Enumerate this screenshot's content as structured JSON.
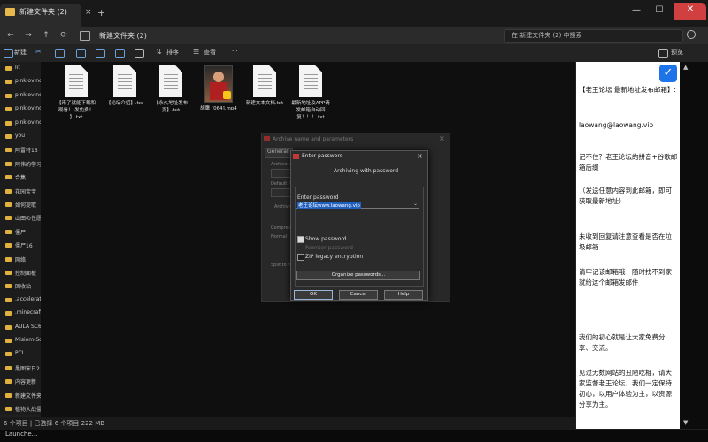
{
  "window": {
    "tab_title": "新建文件夹 (2)",
    "tab_close": "×",
    "tab_add": "+",
    "caption_minimize": "—",
    "caption_maximize": "☐",
    "caption_close": "✕"
  },
  "navigation": {
    "back": "←",
    "forward": "→",
    "up": "↑",
    "refresh": "⟳",
    "breadcrumb": "新建文件夹 (2)",
    "search_placeholder": "在 新建文件夹 (2) 中搜索"
  },
  "toolbar": {
    "new_label": "新建",
    "sort_label": "排序",
    "view_label": "查看",
    "more_label": "···",
    "preview_label": "预览"
  },
  "sidebar": {
    "items": [
      "lit",
      "pinklovinc",
      "pinklovinc",
      "pinklovinc",
      "pinklovinc",
      "you",
      "阿雷特13",
      "阿伟的学习",
      "合集",
      "花园宝宝",
      "如何提取",
      "山田の性愿",
      "僵尸",
      "僵尸16",
      "网络",
      "控制面板",
      "回收站",
      ".accelerate",
      ".minecraft",
      "AULA SC68",
      "Misiom-Sou",
      "PCL",
      "黑图宋日2",
      "内容更新",
      "新建文件夹",
      "植物大战僵尸"
    ]
  },
  "files": [
    {
      "name": "【来了就能下载和观看！ 发免费！ 】.txt",
      "type": "text"
    },
    {
      "name": "【论坛介绍】.txt",
      "type": "text"
    },
    {
      "name": "【永久地址发布页】.txt",
      "type": "text"
    },
    {
      "name": "胡鹰 [064].mp4",
      "type": "video"
    },
    {
      "name": "新建文本文档.txt",
      "type": "text"
    },
    {
      "name": "最新地址及APP请发邮箱自动回复！！！.txt",
      "type": "text"
    }
  ],
  "status": {
    "text": "6 个项目 | 已选择 6 个项目 222 MB"
  },
  "background_dialog": {
    "title": "Archive name and parameters",
    "tab_general": "General",
    "label_archive": "Archive n",
    "label_default": "Default P",
    "label_archive_format": "Archive",
    "label_compression": "Compress",
    "label_split": "Split to v",
    "field_normal": "Normal"
  },
  "dialog": {
    "title": "Enter password",
    "close": "×",
    "header": "Archiving with password",
    "enter_password_label": "Enter password",
    "password_value": "老王论坛www.laowang.vip",
    "show_password_label": "Show password",
    "reenter_label": "Reenter password",
    "zip_legacy_label": "ZIP legacy encryption",
    "organize_button": "Organize passwords...",
    "ok_button": "OK",
    "cancel_button": "Cancel",
    "help_button": "Help",
    "show_password_checked": true,
    "zip_legacy_checked": false
  },
  "ad": {
    "lines": [
      "【老王论坛 最新地址发布邮箱】:",
      "laowang@laowang.vip",
      "记不住？老王论坛的拼音+谷歌邮箱后缀",
      "（发送任意内容到此邮箱，即可获取最新地址）",
      "未收到回复请注意查看是否在垃圾邮箱",
      "请牢记该邮箱哦！随时找不到家就给这个邮箱发邮件",
      "我们的初心就是让大家免费分享、交流。",
      "见过无数网站的丑陋吃相，请大家监督老王论坛，我们一定保持初心，以用户体验为主，以资源分享为主。"
    ],
    "brand_color": "#1d73e8"
  },
  "taskbar": {
    "text": "Launche..."
  }
}
